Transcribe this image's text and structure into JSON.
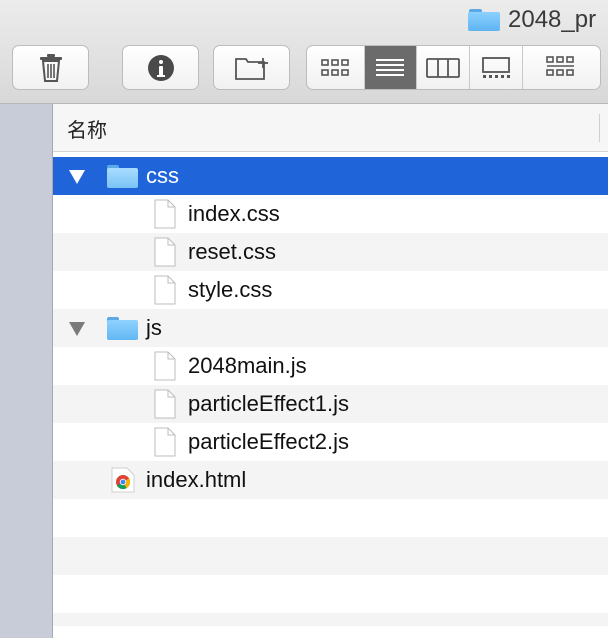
{
  "window": {
    "title": "2048_pr"
  },
  "header": {
    "name_column": "名称"
  },
  "toolbar": {
    "buttons": [
      {
        "name": "trash-icon"
      },
      {
        "name": "info-icon"
      },
      {
        "name": "new-folder-icon"
      }
    ],
    "view_modes": [
      {
        "name": "icon-view-icon",
        "active": false
      },
      {
        "name": "list-view-icon",
        "active": true
      },
      {
        "name": "column-view-icon",
        "active": false
      },
      {
        "name": "gallery-view-icon",
        "active": false
      }
    ],
    "group_icon": "group-icon"
  },
  "files": [
    {
      "label": "css",
      "kind": "folder",
      "level": 0,
      "expanded": true,
      "selected": true
    },
    {
      "label": "index.css",
      "kind": "document",
      "level": 1
    },
    {
      "label": "reset.css",
      "kind": "document",
      "level": 1
    },
    {
      "label": "style.css",
      "kind": "document",
      "level": 1
    },
    {
      "label": "js",
      "kind": "folder",
      "level": 0,
      "expanded": true,
      "selected": false
    },
    {
      "label": "2048main.js",
      "kind": "document",
      "level": 1
    },
    {
      "label": "particleEffect1.js",
      "kind": "document",
      "level": 1
    },
    {
      "label": "particleEffect2.js",
      "kind": "document",
      "level": 1
    },
    {
      "label": "index.html",
      "kind": "chrome-html",
      "level": 0
    }
  ],
  "colors": {
    "selection": "#1f65d9",
    "folder": "#6bbcf5",
    "sidebar": "#c7ccd8"
  }
}
